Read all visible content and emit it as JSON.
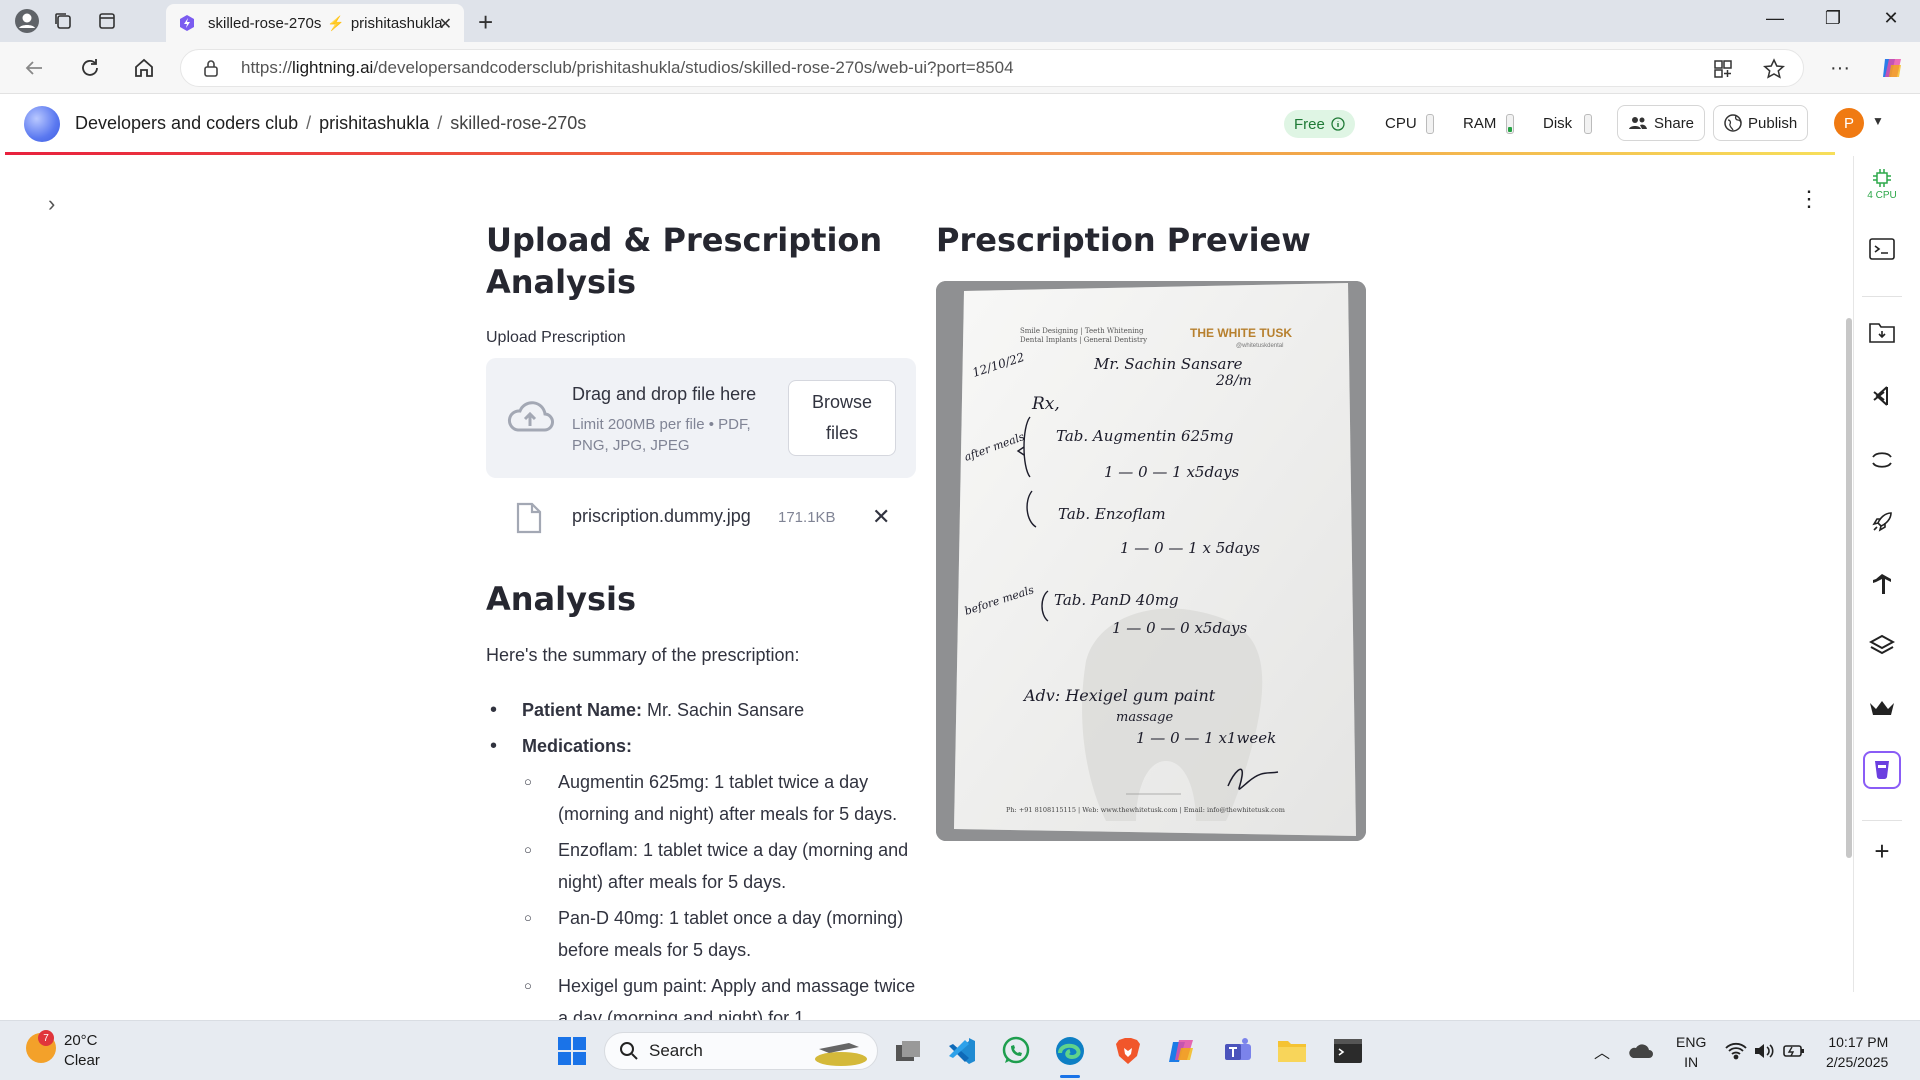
{
  "browser": {
    "tab_title": "skilled-rose-270s",
    "tab_title_2": "prishitashukla",
    "url_prefix": "https://",
    "url_host": "lightning.ai",
    "url_path": "/developersandcodersclub/prishitashukla/studios/skilled-rose-270s/web-ui?port=8504"
  },
  "header": {
    "breadcrumb_1": "Developers and coders club",
    "breadcrumb_2": "prishitashukla",
    "breadcrumb_3": "skilled-rose-270s",
    "free_label": "Free",
    "cpu_label": "CPU",
    "ram_label": "RAM",
    "disk_label": "Disk",
    "share_label": "Share",
    "publish_label": "Publish",
    "avatar_letter": "P"
  },
  "sidebar_right": {
    "cpu_label": "4 CPU"
  },
  "upload": {
    "title": "Upload & Prescription Analysis",
    "title_line1": "Upload & Prescription",
    "title_line2": "Analysis",
    "field_label": "Upload Prescription",
    "drop_text": "Drag and drop file here",
    "limit_text": "Limit 200MB per file • PDF, PNG, JPG, JPEG",
    "browse_label": "Browse files",
    "file_name": "priscription.dummy.jpg",
    "file_size": "171.1KB"
  },
  "analysis": {
    "title": "Analysis",
    "summary_intro": "Here's the summary of the prescription:",
    "patient_label": "Patient Name:",
    "patient_value": " Mr. Sachin Sansare",
    "medications_label": "Medications:",
    "medications": [
      "Augmentin 625mg: 1 tablet twice a day (morning and night) after meals for 5 days.",
      "Enzoflam: 1 tablet twice a day (morning and night) after meals for 5 days.",
      "Pan-D 40mg: 1 tablet once a day (morning) before meals for 5 days.",
      "Hexigel gum paint: Apply and massage twice a day (morning and night) for 1"
    ]
  },
  "preview": {
    "title": "Prescription Preview",
    "clinic_tagline_1": "Smile Designing | Teeth Whitening",
    "clinic_tagline_2": "Dental Implants | General Dentistry",
    "clinic_name": "THE WHITE TUSK",
    "clinic_handle": "@whitetuskdental",
    "hw_date": "12/10/22",
    "hw_patient": "Mr. Sachin Sansare",
    "hw_age": "28/m",
    "hw_rx": "Rx,",
    "hw_after_meals": "after meals",
    "hw_line1": "Tab. Augmentin 625mg",
    "hw_dose1": "1 — 0 — 1   x5days",
    "hw_line2": "Tab. Enzoflam",
    "hw_dose2": "1 — 0 — 1  x 5days",
    "hw_before_meals": "before meals",
    "hw_line3": "Tab. PanD 40mg",
    "hw_dose3": "1 — 0 — 0  x5days",
    "hw_adv": "Adv: Hexigel gum paint",
    "hw_massage": "massage",
    "hw_dose4": "1 — 0 — 1   x1week",
    "footer": "Ph: +91 8108115115 | Web: www.thewhitetusk.com | Email: info@thewhitetusk.com"
  },
  "taskbar": {
    "weather_badge": "7",
    "temp": "20°C",
    "weather_desc": "Clear",
    "search_label": "Search",
    "lang_1": "ENG",
    "lang_2": "IN",
    "time": "10:17 PM",
    "date": "2/25/2025"
  },
  "colors": {
    "free_badge": "#dff5e4",
    "avatar": "#f07a12",
    "accent_gradient_start": "#e8213e",
    "accent_gradient_end": "#f7df5a"
  }
}
